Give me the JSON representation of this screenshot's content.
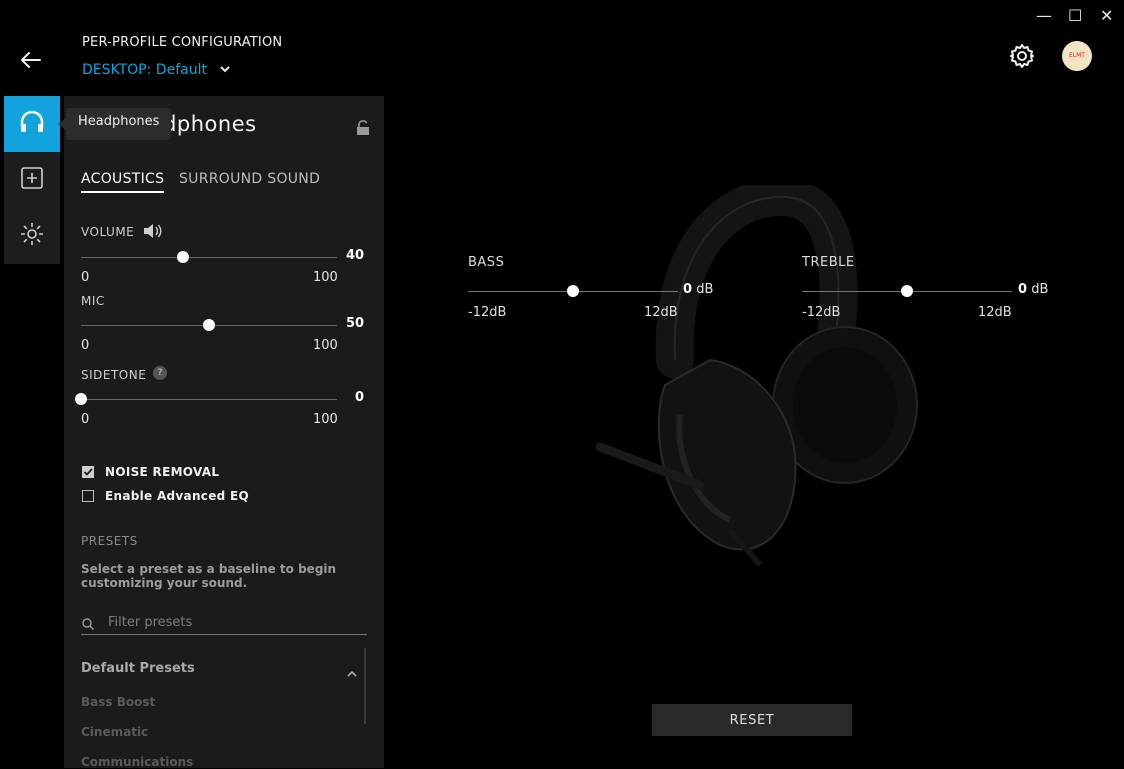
{
  "window": {
    "minimize": "—",
    "maximize": "☐",
    "close": "✕"
  },
  "header": {
    "title": "PER-PROFILE CONFIGURATION",
    "profile_type": "DESKTOP:",
    "profile_name": "Default",
    "avatar_text": "ELMT"
  },
  "tooltip": "Headphones",
  "panel": {
    "title": "Headphones",
    "tabs": [
      "ACOUSTICS",
      "SURROUND SOUND"
    ],
    "volume": {
      "label": "VOLUME",
      "value": "40",
      "min": "0",
      "max": "100",
      "level": 0.4
    },
    "mic": {
      "label": "MIC",
      "value": "50",
      "min": "0",
      "max": "100",
      "level": 0.5
    },
    "sidetone": {
      "label": "SIDETONE",
      "help": "?",
      "value": "0",
      "min": "0",
      "max": "100",
      "level": 0
    },
    "noise_removal": {
      "label": "NOISE REMOVAL",
      "checked": true
    },
    "advanced_eq": {
      "label": "Enable Advanced EQ",
      "checked": false
    },
    "presets": {
      "heading": "PRESETS",
      "description": "Select a preset as a baseline to begin customizing your sound.",
      "filter_placeholder": "Filter presets",
      "group": "Default Presets",
      "items": [
        "Bass Boost",
        "Cinematic",
        "Communications"
      ]
    }
  },
  "eq": {
    "bass": {
      "label": "BASS",
      "value": "0",
      "unit": "dB",
      "min": "-12dB",
      "max": "12dB",
      "level": 0.5
    },
    "treble": {
      "label": "TREBLE",
      "value": "0",
      "unit": "dB",
      "min": "-12dB",
      "max": "12dB",
      "level": 0.5
    }
  },
  "reset_label": "RESET",
  "colors": {
    "accent": "#13a3dc",
    "panel": "#1b1b1b",
    "background": "#000000"
  }
}
